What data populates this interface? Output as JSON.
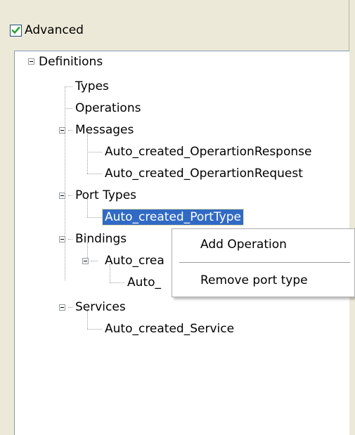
{
  "advanced": {
    "label": "Advanced",
    "checked": true
  },
  "tree": {
    "root": "Definitions",
    "types": "Types",
    "operations": "Operations",
    "messages": {
      "label": "Messages",
      "items": [
        "Auto_created_OperartionResponse",
        "Auto_created_OperartionRequest"
      ]
    },
    "port_types": {
      "label": "Port Types",
      "items": [
        "Auto_created_PortType"
      ]
    },
    "bindings": {
      "label": "Bindings",
      "child_label": "Auto_crea",
      "grandchild_label": "Auto_"
    },
    "services": {
      "label": "Services",
      "items": [
        "Auto_created_Service"
      ]
    }
  },
  "context_menu": {
    "items": [
      "Add Operation",
      "Remove port type"
    ]
  },
  "icons": {
    "expander": "minus-expander-icon",
    "check": "check-icon"
  },
  "colors": {
    "selection": "#316ac5",
    "panel": "#ece9d8",
    "checkmark": "#21a121"
  }
}
